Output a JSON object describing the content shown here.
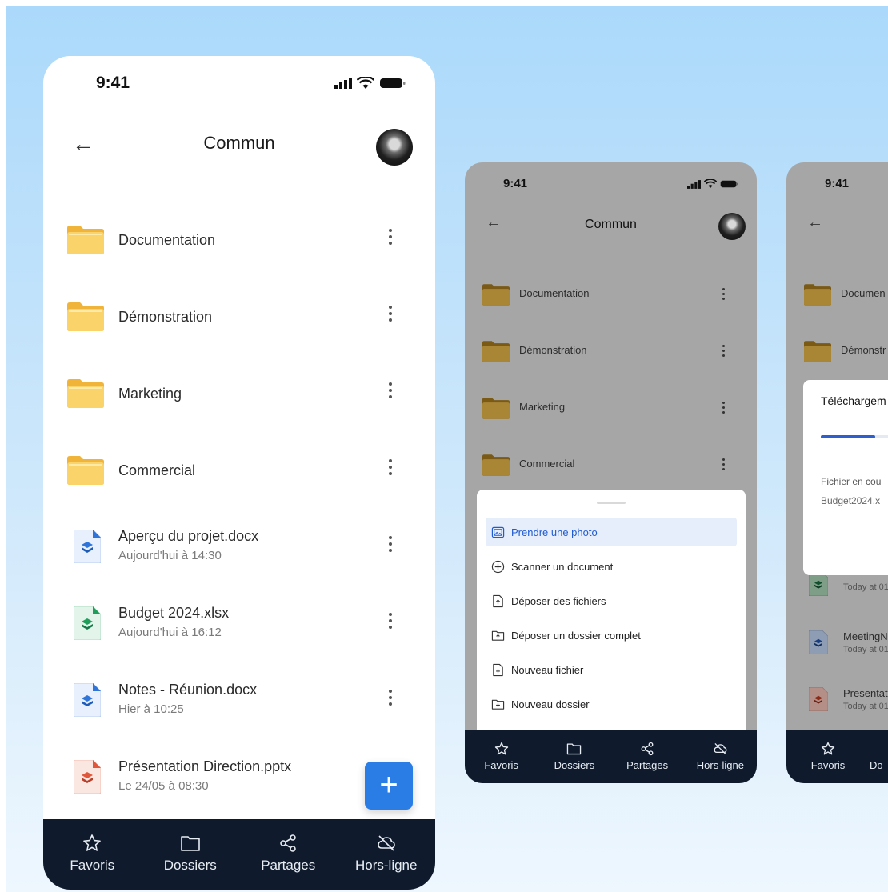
{
  "phone_main": {
    "status_time": "9:41",
    "title": "Commun",
    "items": [
      {
        "name": "Documentation",
        "sub": "",
        "type": "folder"
      },
      {
        "name": "Démonstration",
        "sub": "",
        "type": "folder"
      },
      {
        "name": "Marketing",
        "sub": "",
        "type": "folder"
      },
      {
        "name": "Commercial",
        "sub": "",
        "type": "folder"
      },
      {
        "name": "Aperçu du projet.docx",
        "sub": "Aujourd'hui à 14:30",
        "type": "docx"
      },
      {
        "name": "Budget 2024.xlsx",
        "sub": "Aujourd'hui à 16:12",
        "type": "xlsx"
      },
      {
        "name": "Notes - Réunion.docx",
        "sub": "Hier à 10:25",
        "type": "docx"
      },
      {
        "name": "Présentation Direction.pptx",
        "sub": "Le 24/05 à 08:30",
        "type": "pptx"
      }
    ],
    "fab_label": "+",
    "nav": [
      "Favoris",
      "Dossiers",
      "Partages",
      "Hors-ligne"
    ]
  },
  "phone_sheet": {
    "status_time": "9:41",
    "title": "Commun",
    "folders": [
      "Documentation",
      "Démonstration",
      "Marketing",
      "Commercial"
    ],
    "sheet_options": [
      {
        "label": "Prendre une photo",
        "icon": "photo-icon",
        "selected": true
      },
      {
        "label": "Scanner un document",
        "icon": "plus-circle-icon",
        "selected": false
      },
      {
        "label": "Déposer des fichiers",
        "icon": "file-upload-icon",
        "selected": false
      },
      {
        "label": "Déposer un dossier complet",
        "icon": "folder-upload-icon",
        "selected": false
      },
      {
        "label": "Nouveau fichier",
        "icon": "file-plus-icon",
        "selected": false
      },
      {
        "label": "Nouveau dossier",
        "icon": "folder-plus-icon",
        "selected": false
      }
    ],
    "nav": [
      "Favoris",
      "Dossiers",
      "Partages",
      "Hors-ligne"
    ]
  },
  "phone_upload": {
    "status_time": "9:41",
    "folders": [
      "Documen",
      "Démonstr"
    ],
    "dialog_title": "Téléchargem",
    "progress": 0.34,
    "file_label": "Fichier en cou",
    "file_name": "Budget2024.x",
    "files": [
      {
        "name": "",
        "sub": "Today at 01",
        "type": "xlsx"
      },
      {
        "name": "MeetingN",
        "sub": "Today at 01",
        "type": "docx"
      },
      {
        "name": "Presentat",
        "sub": "Today at 01",
        "type": "pptx"
      }
    ],
    "nav": [
      "Favoris",
      "Do"
    ]
  },
  "colors": {
    "accent": "#2b7de6",
    "nav_bg": "#0f1b2c",
    "folder": "#fbd36b",
    "docx": "#2f74d9",
    "xlsx": "#1f9d5a",
    "pptx": "#e1573b"
  }
}
